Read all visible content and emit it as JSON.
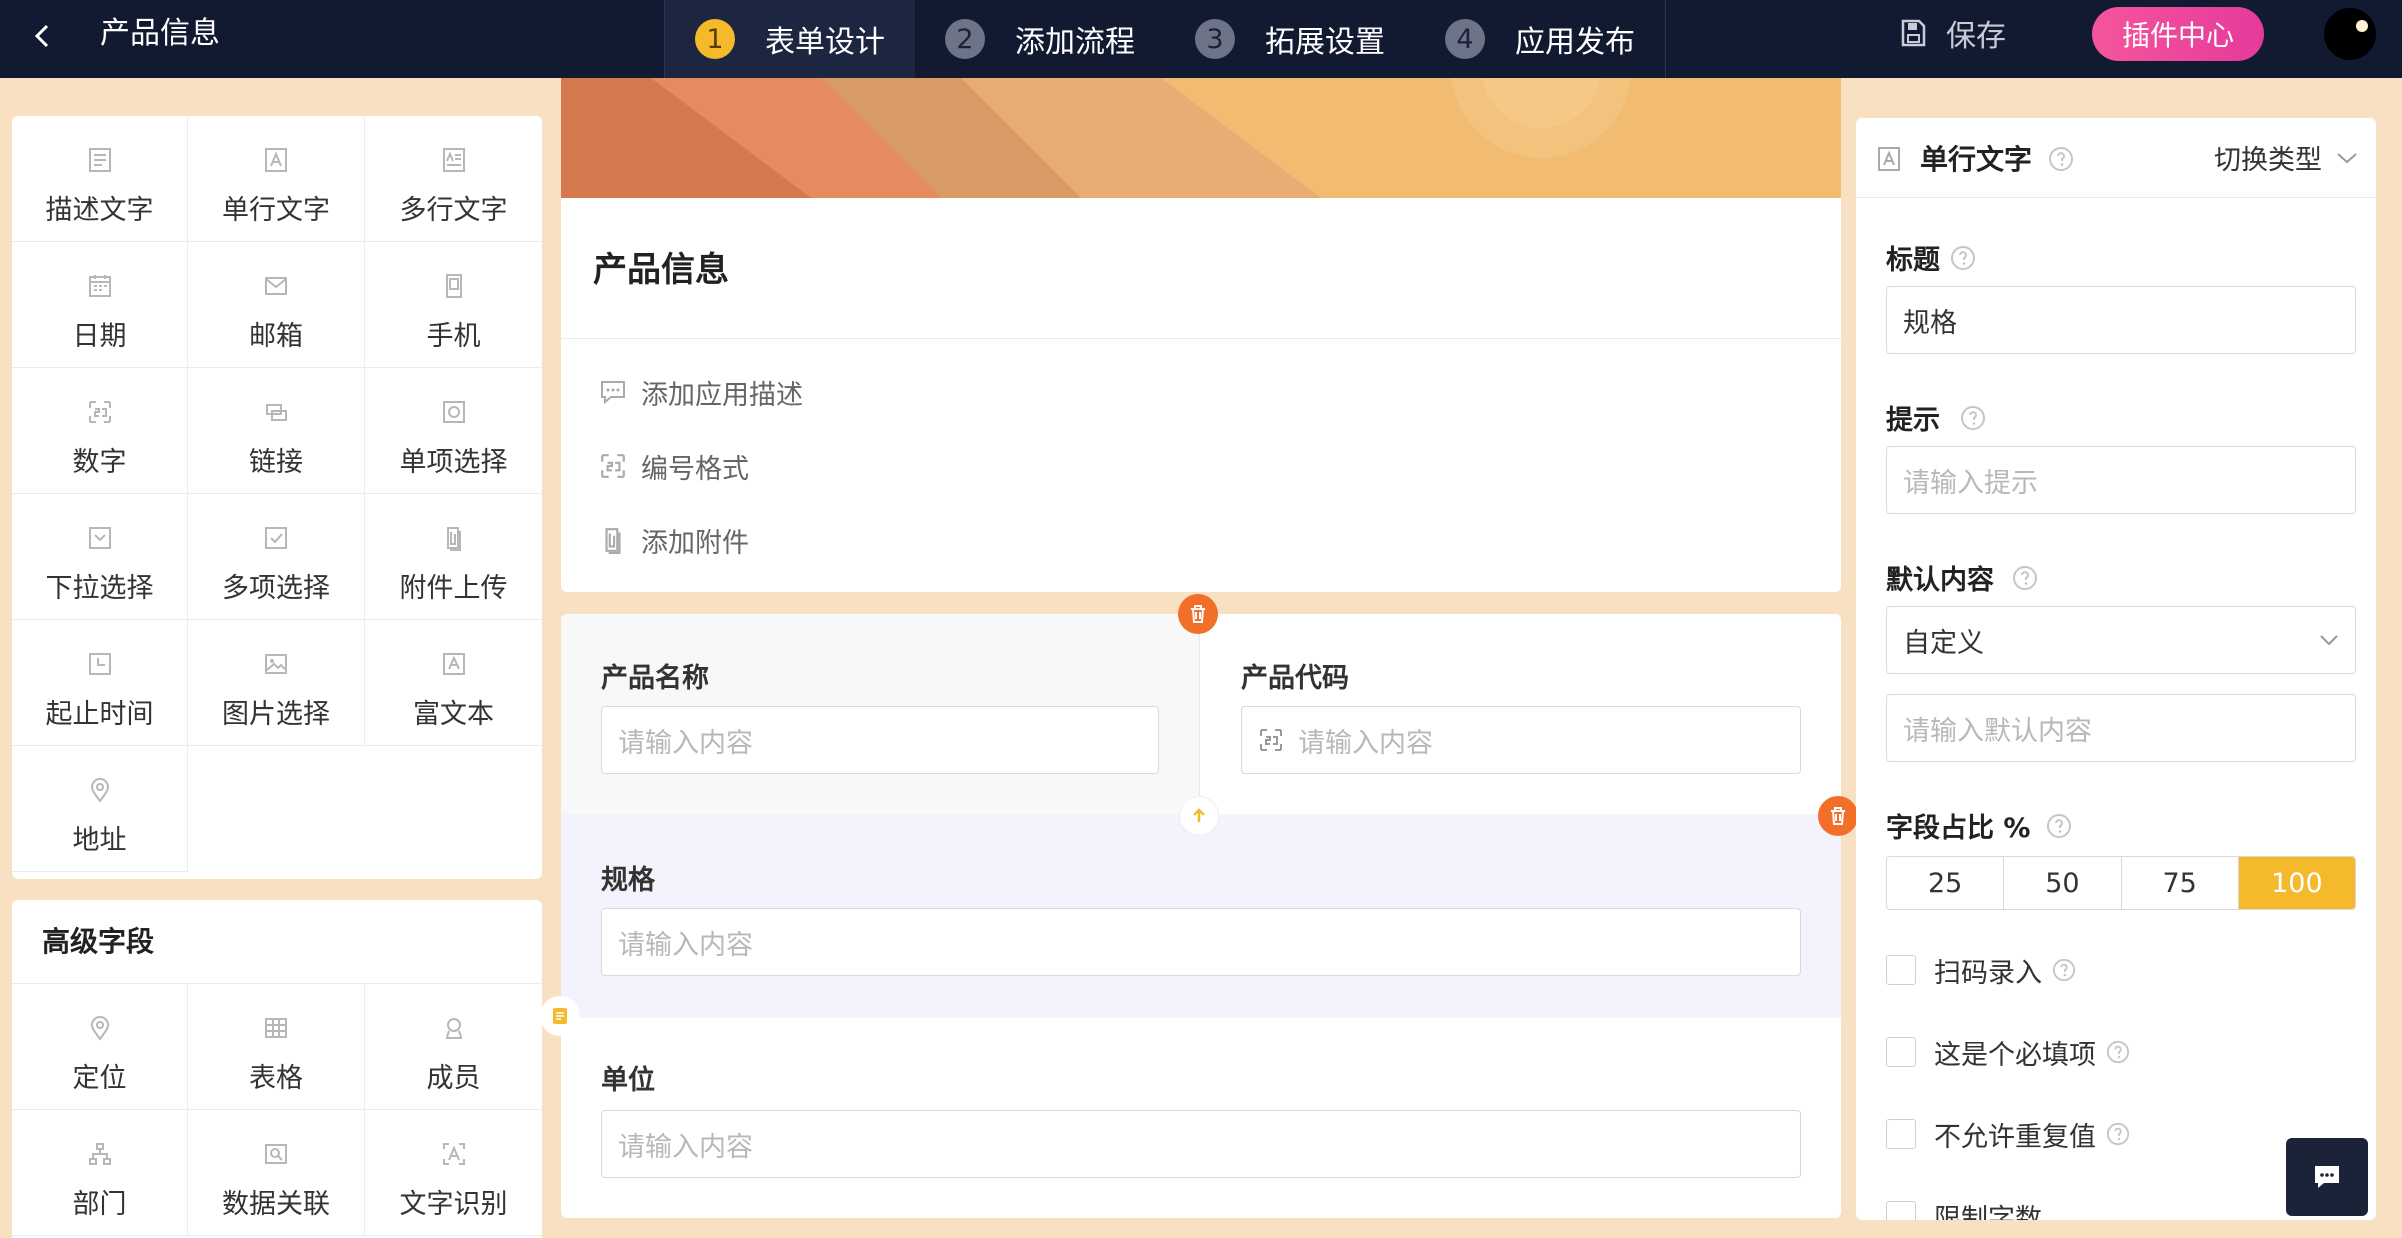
{
  "header": {
    "back_icon": "chevron-left-icon",
    "title": "产品信息",
    "steps": [
      {
        "num": "1",
        "label": "表单设计",
        "active": true
      },
      {
        "num": "2",
        "label": "添加流程",
        "active": false
      },
      {
        "num": "3",
        "label": "拓展设置",
        "active": false
      },
      {
        "num": "4",
        "label": "应用发布",
        "active": false
      }
    ],
    "save_label": "保存",
    "plugin_label": "插件中心",
    "accent_color": "#f5b92c",
    "plugin_color": "#e53a9b"
  },
  "palette": {
    "basic": [
      {
        "label": "描述文字",
        "icon": "text-doc-icon"
      },
      {
        "label": "单行文字",
        "icon": "text-a-icon"
      },
      {
        "label": "多行文字",
        "icon": "textarea-icon"
      },
      {
        "label": "日期",
        "icon": "calendar-icon"
      },
      {
        "label": "邮箱",
        "icon": "mail-icon"
      },
      {
        "label": "手机",
        "icon": "phone-icon"
      },
      {
        "label": "数字",
        "icon": "number-icon"
      },
      {
        "label": "链接",
        "icon": "link-icon"
      },
      {
        "label": "单项选择",
        "icon": "radio-icon"
      },
      {
        "label": "下拉选择",
        "icon": "dropdown-icon"
      },
      {
        "label": "多项选择",
        "icon": "checkbox-icon"
      },
      {
        "label": "附件上传",
        "icon": "attachment-icon"
      },
      {
        "label": "起止时间",
        "icon": "clock-icon"
      },
      {
        "label": "图片选择",
        "icon": "image-icon"
      },
      {
        "label": "富文本",
        "icon": "rich-text-icon"
      },
      {
        "label": "地址",
        "icon": "location-pin-icon"
      }
    ],
    "advanced_title": "高级字段",
    "advanced": [
      {
        "label": "定位",
        "icon": "location-pin-icon"
      },
      {
        "label": "表格",
        "icon": "table-icon"
      },
      {
        "label": "成员",
        "icon": "user-icon"
      },
      {
        "label": "部门",
        "icon": "org-chart-icon"
      },
      {
        "label": "数据关联",
        "icon": "data-link-icon"
      },
      {
        "label": "文字识别",
        "icon": "ocr-icon"
      }
    ]
  },
  "form": {
    "title": "产品信息",
    "links": [
      {
        "label": "添加应用描述",
        "icon": "comment-icon"
      },
      {
        "label": "编号格式",
        "icon": "number-icon"
      },
      {
        "label": "添加附件",
        "icon": "attachment-icon"
      }
    ],
    "fields": [
      {
        "label": "产品名称",
        "placeholder": "请输入内容"
      },
      {
        "label": "产品代码",
        "placeholder": "请输入内容"
      },
      {
        "label": "规格",
        "placeholder": "请输入内容"
      },
      {
        "label": "单位",
        "placeholder": "请输入内容"
      }
    ]
  },
  "props": {
    "type_label": "单行文字",
    "switch_label": "切换类型",
    "title_label": "标题",
    "title_value": "规格",
    "hint_label": "提示",
    "hint_placeholder": "请输入提示",
    "default_label": "默认内容",
    "default_mode": "自定义",
    "default_placeholder": "请输入默认内容",
    "ratio_label": "字段占比 %",
    "ratio_options": [
      "25",
      "50",
      "75",
      "100"
    ],
    "ratio_selected": "100",
    "checks": [
      {
        "label": "扫码录入",
        "checked": false
      },
      {
        "label": "这是个必填项",
        "checked": false
      },
      {
        "label": "不允许重复值",
        "checked": false
      },
      {
        "label": "限制字数",
        "checked": false
      }
    ]
  }
}
